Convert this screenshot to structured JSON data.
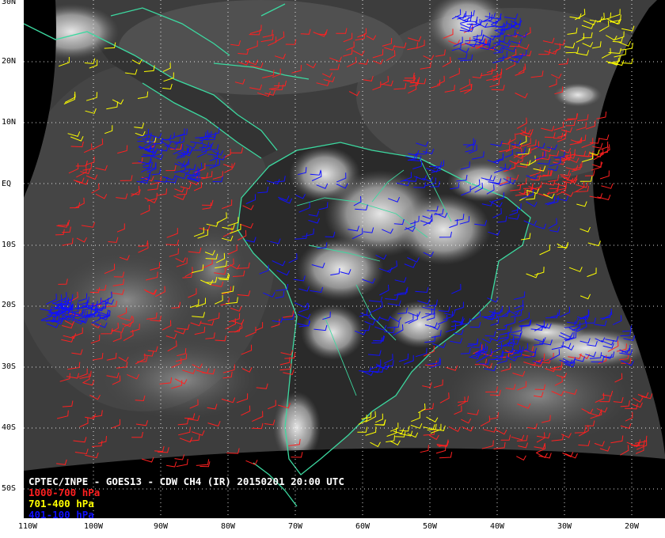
{
  "caption": {
    "title": "CPTEC/INPE - GOES13 - CDW CH4 (IR) 20150201 20:00 UTC",
    "title_color": "#ffffff",
    "legend": [
      {
        "label": "1000-700 hPa",
        "color": "#ff2020"
      },
      {
        "label": "701-400 hPa",
        "color": "#ffff00"
      },
      {
        "label": "401-100 hPa",
        "color": "#1010ff"
      }
    ]
  },
  "lat_labels": [
    "30N",
    "20N",
    "10N",
    "EQ",
    "10S",
    "20S",
    "30S",
    "40S",
    "50S"
  ],
  "lon_labels": [
    "110W",
    "100W",
    "90W",
    "80W",
    "70W",
    "60W",
    "50W",
    "40W",
    "30W",
    "20W"
  ],
  "colors": {
    "coastline": "#3cd9a0",
    "gridlines": "#ffffff",
    "background": "#000000",
    "cloud_dark": "#3a3a3a",
    "cloud_bright": "#e8e8e8"
  }
}
